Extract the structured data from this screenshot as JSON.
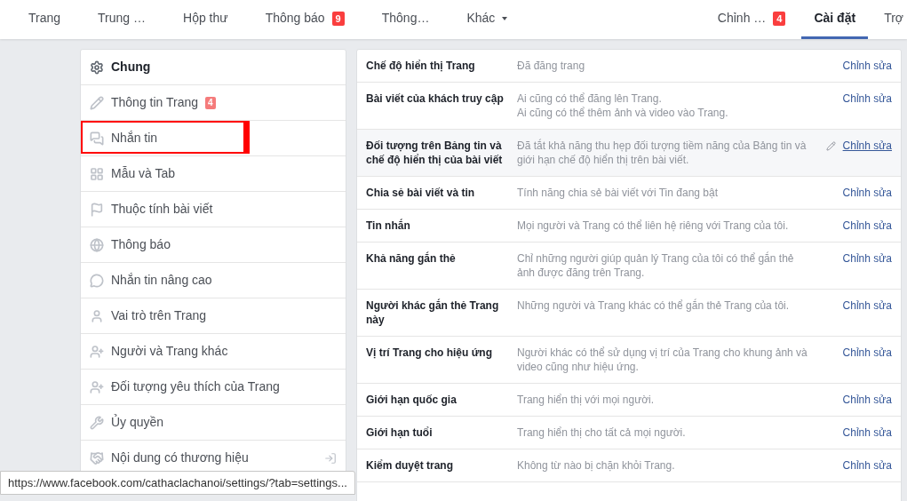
{
  "nav": {
    "left": [
      {
        "label": "Trang",
        "selected": false
      },
      {
        "label": "Trung …",
        "selected": false
      },
      {
        "label": "Hộp thư",
        "selected": false
      },
      {
        "label": "Thông báo",
        "badge": "9",
        "selected": false
      },
      {
        "label": "Thông…",
        "selected": false
      },
      {
        "label": "Khác",
        "dropdown": true,
        "selected": false
      }
    ],
    "right": [
      {
        "label": "Chỉnh …",
        "badge": "4",
        "selected": false
      },
      {
        "label": "Cài đặt",
        "selected": true
      },
      {
        "label": "Trợ",
        "selected": false
      }
    ]
  },
  "sidebar": {
    "items": [
      {
        "label": "Chung",
        "selected": true,
        "highlighted": false
      },
      {
        "label": "Thông tin Trang",
        "badge": "4",
        "selected": false,
        "highlighted": false
      },
      {
        "label": "Nhắn tin",
        "selected": false,
        "highlighted": true
      },
      {
        "label": "Mẫu và Tab",
        "selected": false,
        "highlighted": false
      },
      {
        "label": "Thuộc tính bài viết",
        "selected": false,
        "highlighted": false
      },
      {
        "label": "Thông báo",
        "selected": false,
        "highlighted": false
      },
      {
        "label": "Nhắn tin nâng cao",
        "selected": false,
        "highlighted": false
      },
      {
        "label": "Vai trò trên Trang",
        "selected": false,
        "highlighted": false
      },
      {
        "label": "Người và Trang khác",
        "selected": false,
        "highlighted": false
      },
      {
        "label": "Đối tượng yêu thích của Trang",
        "selected": false,
        "highlighted": false
      },
      {
        "label": "Ủy quyền",
        "selected": false,
        "highlighted": false
      },
      {
        "label": "Nội dung có thương hiệu",
        "selected": false,
        "highlighted": false
      }
    ]
  },
  "settings": [
    {
      "title": "Chế độ hiển thị Trang",
      "lines": [
        "Đã đăng trang"
      ],
      "action": "Chỉnh sửa",
      "hovered": false
    },
    {
      "title": "Bài viết của khách truy cập",
      "lines": [
        "Ai cũng có thể đăng lên Trang.",
        "Ai cũng có thể thêm ảnh và video vào Trang."
      ],
      "action": "Chỉnh sửa",
      "hovered": false
    },
    {
      "title": "Đối tượng trên Bảng tin và chế độ hiển thị của bài viết",
      "lines": [
        "Đã tắt khả năng thu hẹp đối tượng tiềm năng của Bảng tin và giới hạn chế độ hiển thị trên bài viết."
      ],
      "action": "Chỉnh sửa",
      "hovered": true
    },
    {
      "title": "Chia sẻ bài viết và tin",
      "lines": [
        "Tính năng chia sẻ bài viết với Tin đang bật"
      ],
      "action": "Chỉnh sửa",
      "hovered": false
    },
    {
      "title": "Tin nhắn",
      "lines": [
        "Mọi người và Trang có thể liên hệ riêng với Trang của tôi."
      ],
      "action": "Chỉnh sửa",
      "hovered": false
    },
    {
      "title": "Khả năng gắn thẻ",
      "lines": [
        "Chỉ những người giúp quản lý Trang của tôi có thể gắn thẻ ảnh được đăng trên Trang."
      ],
      "action": "Chỉnh sửa",
      "hovered": false
    },
    {
      "title": "Người khác gắn thẻ Trang này",
      "lines": [
        "Những người và Trang khác có thể gắn thẻ Trang của tôi."
      ],
      "action": "Chỉnh sửa",
      "hovered": false
    },
    {
      "title": "Vị trí Trang cho hiệu ứng",
      "lines": [
        "Người khác có thể sử dụng vị trí của Trang cho khung ảnh và video cũng như hiệu ứng."
      ],
      "action": "Chỉnh sửa",
      "hovered": false
    },
    {
      "title": "Giới hạn quốc gia",
      "lines": [
        "Trang hiển thị với mọi người."
      ],
      "action": "Chỉnh sửa",
      "hovered": false
    },
    {
      "title": "Giới hạn tuổi",
      "lines": [
        "Trang hiển thị cho tất cả mọi người."
      ],
      "action": "Chỉnh sửa",
      "hovered": false
    },
    {
      "title": "Kiểm duyệt trang",
      "lines": [
        "Không từ nào bị chặn khỏi Trang."
      ],
      "action": "Chỉnh sửa",
      "hovered": false
    }
  ],
  "status_bar": {
    "url": "https://www.facebook.com/cathaclachanoi/settings/?tab=settings..."
  }
}
